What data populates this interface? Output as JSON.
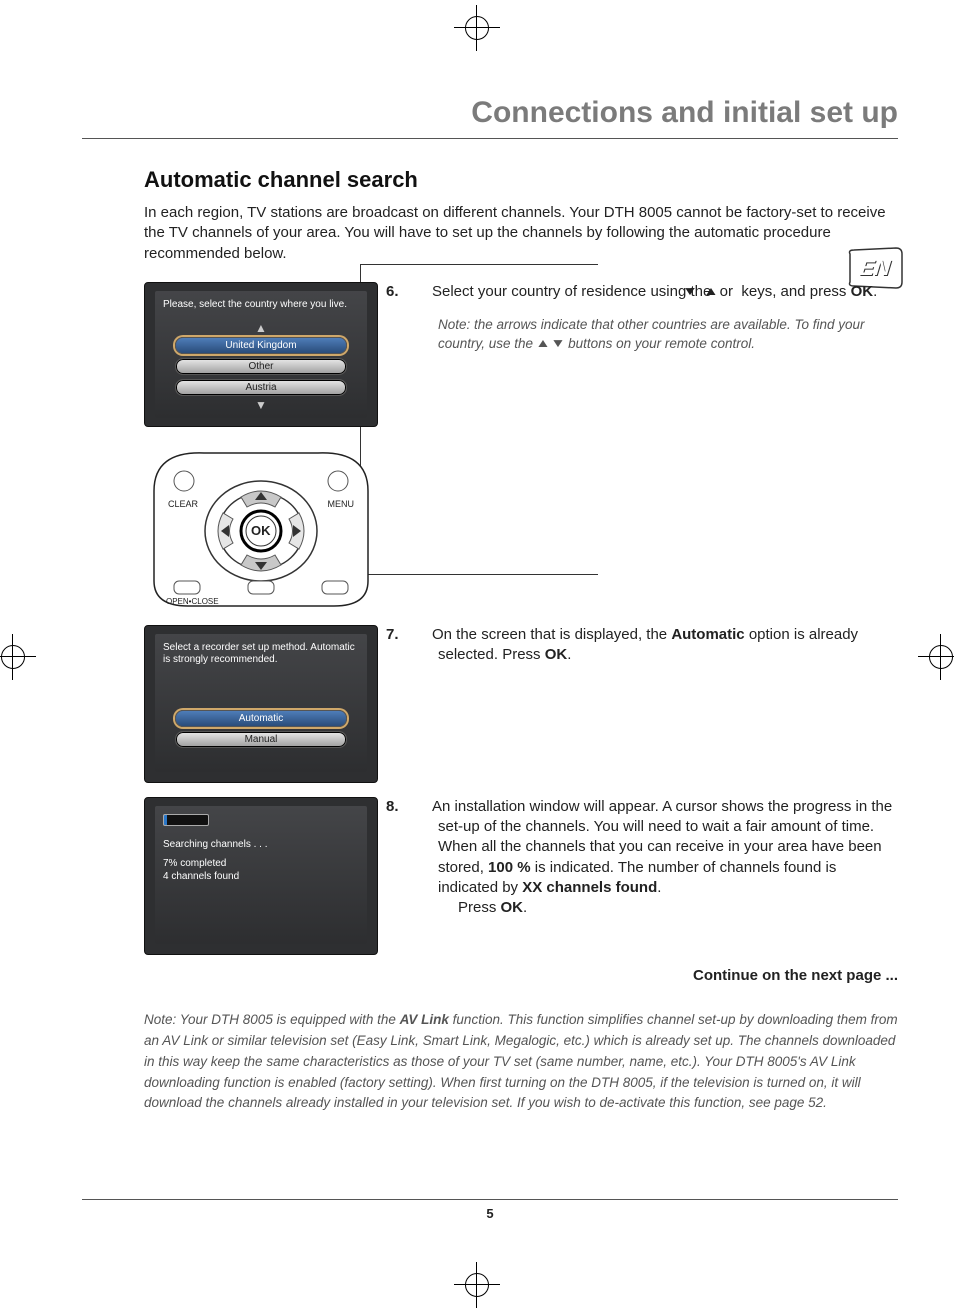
{
  "header": {
    "title": "Connections and initial set up"
  },
  "lang_tab": "EN",
  "page_number": "5",
  "section_heading": "Automatic channel search",
  "intro": "In each region, TV stations are broadcast on different channels. Your DTH 8005 cannot be factory-set to receive the TV channels of your area. You will have to set up the channels by following the automatic procedure recommended below.",
  "screens": {
    "country": {
      "prompt": "Please, select the country where you live.",
      "options": [
        "United Kingdom",
        "Other",
        "Austria"
      ],
      "selected": "United Kingdom"
    },
    "method": {
      "prompt": "Select a recorder set up method. Automatic is strongly recommended.",
      "options": [
        "Automatic",
        "Manual"
      ],
      "selected": "Automatic"
    },
    "progress": {
      "title": "Searching channels . . .",
      "line1": "7% completed",
      "line2": "4 channels found"
    }
  },
  "remote_labels": {
    "clear": "CLEAR",
    "menu": "MENU",
    "ok": "OK",
    "open": "OPEN•CLOSE"
  },
  "steps": {
    "s6_num": "6.",
    "s6_a": "Select your country of residence using the ",
    "s6_b": " or ",
    "s6_c": " keys, and press ",
    "s6_ok": "OK",
    "s6_hint_a": "Note: the arrows indicate that other countries are available. To find your country, use the ",
    "s6_hint_b": " buttons on your remote control.",
    "s7_num": "7.",
    "s7_a": "On the screen that is displayed, the ",
    "s7_bold": "Automatic",
    "s7_b": " option is already selected. Press ",
    "s7_ok": "OK",
    "s8_num": "8.",
    "s8_a": "An installation window will appear. A cursor shows the progress in the set-up of the channels. You will need to wait a fair amount of time. When all the channels that you can receive in your area have been stored, ",
    "s8_bold1": "100 %",
    "s8_b": " is indicated. The number of channels found is indicated by ",
    "s8_bold2": "XX channels found",
    "s8_press": "Press ",
    "s8_ok": "OK"
  },
  "continue": "Continue on the next page ...",
  "footnote": {
    "a": "Note: Your DTH 8005 is equipped with the ",
    "bold": "AV Link",
    "b": " function. This function simplifies channel set-up by downloading them from an AV Link or similar television set (Easy Link, Smart Link, Megalogic, etc.) which is already set up. The channels downloaded in this way keep the same characteristics as those of your TV set (same number, name, etc.). Your DTH 8005's AV Link downloading function is enabled (factory setting). When first turning on the DTH 8005, if the television is turned on, it will download the channels already installed in your television set. If you wish to de-activate this function, see page 52."
  }
}
